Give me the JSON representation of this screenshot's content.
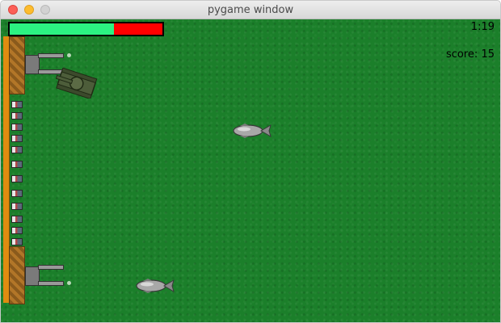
{
  "window": {
    "title": "pygame window"
  },
  "hud": {
    "health_fraction": 0.68,
    "health_color": "#2cf282",
    "damage_color": "#ff0000",
    "timer": "1:19",
    "score": "score: 15"
  },
  "colors": {
    "grass": "#1b7f2a",
    "wall": "#e08c10"
  },
  "icons": {
    "tank": "tank-icon",
    "missile": "missile-icon",
    "turret": "turret-icon"
  }
}
